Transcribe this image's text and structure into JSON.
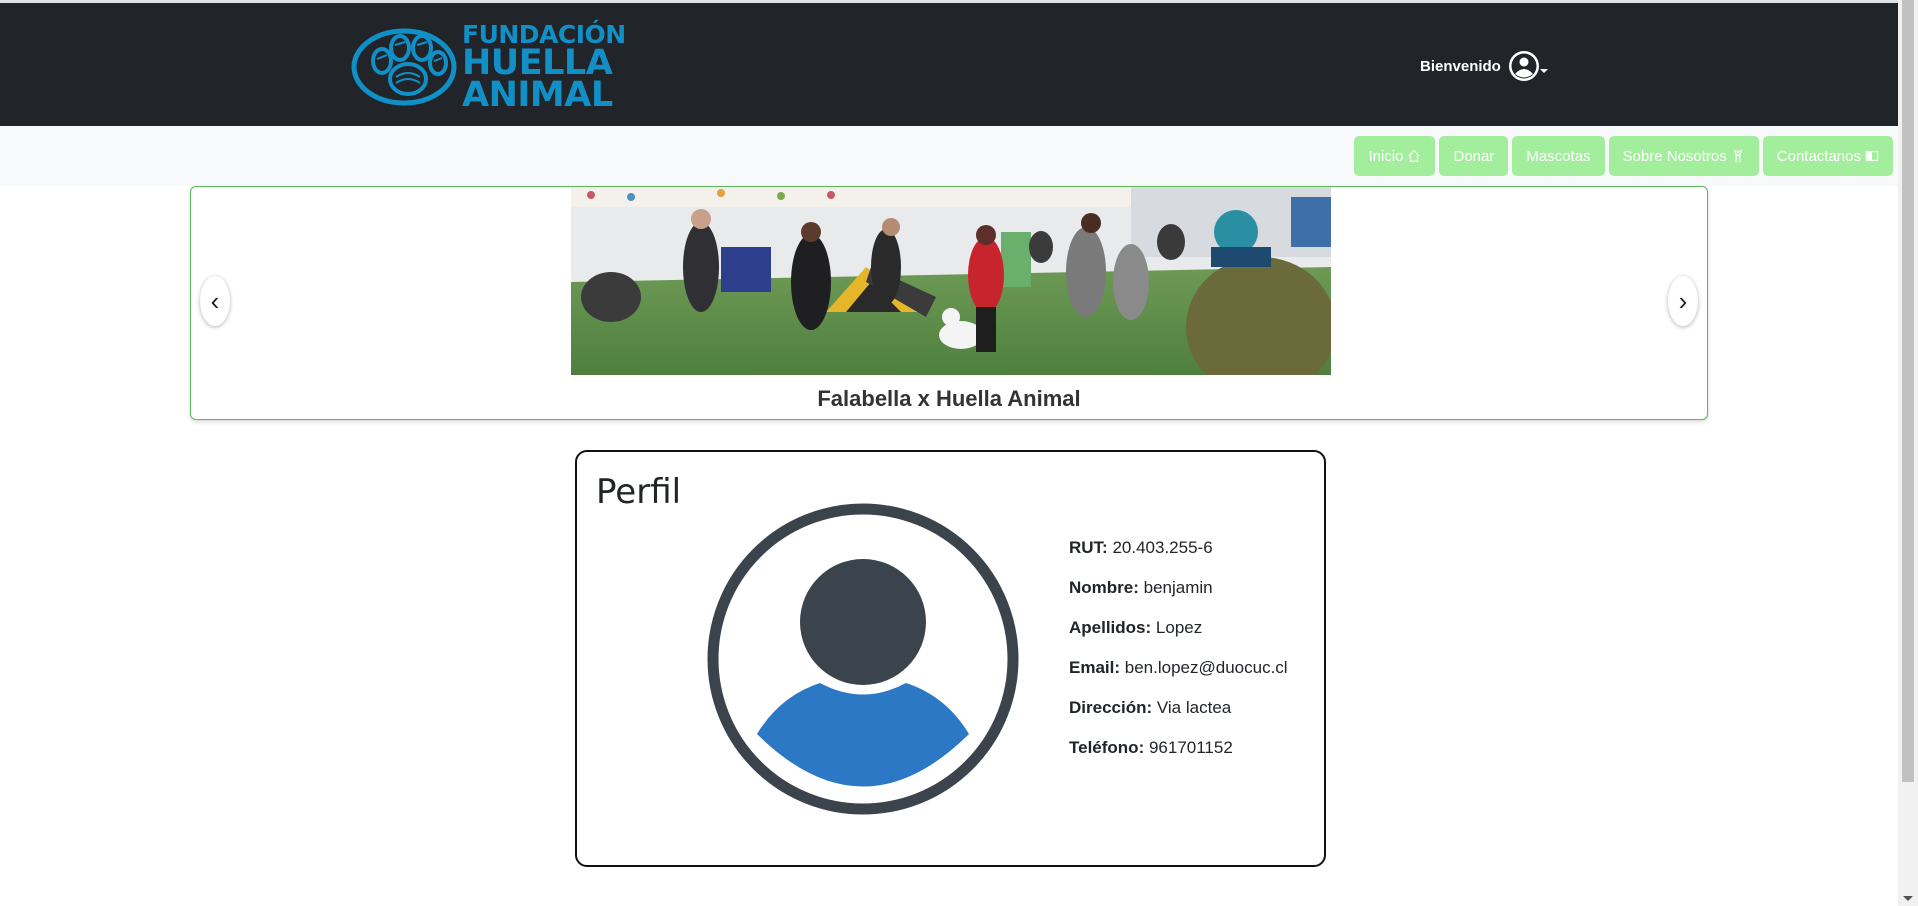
{
  "header": {
    "logo": {
      "line1": "FUNDACIÓN",
      "line2": "HUELLA",
      "line3": "ANIMAL",
      "icon": "paw-print-icon",
      "color": "#1190c7"
    },
    "greeting": "Bienvenido",
    "user_icon": "user-circle-icon",
    "background": "#212529"
  },
  "nav": {
    "items": [
      {
        "label": "Inicio",
        "icon": "house-icon"
      },
      {
        "label": "Donar",
        "icon": ""
      },
      {
        "label": "Mascotas",
        "icon": ""
      },
      {
        "label": "Sobre Nosotros",
        "icon": "person-arms-up-icon"
      },
      {
        "label": "Contactanos",
        "icon": "book-icon"
      }
    ],
    "button_color": "#a3ee9c"
  },
  "carousel": {
    "caption": "Falabella x Huella Animal",
    "prev_symbol": "‹",
    "next_symbol": "›"
  },
  "profile": {
    "title": "Perfil",
    "fields": [
      {
        "label": "RUT:",
        "value": "20.403.255-6"
      },
      {
        "label": "Nombre:",
        "value": "benjamin"
      },
      {
        "label": "Apellidos:",
        "value": "Lopez"
      },
      {
        "label": "Email:",
        "value": "ben.lopez@duocuc.cl"
      },
      {
        "label": "Dirección:",
        "value": "Via lactea"
      },
      {
        "label": "Teléfono:",
        "value": "961701152"
      }
    ],
    "avatar_colors": {
      "ring": "#3b444d",
      "head": "#3b444d",
      "body": "#2d78c4"
    }
  }
}
